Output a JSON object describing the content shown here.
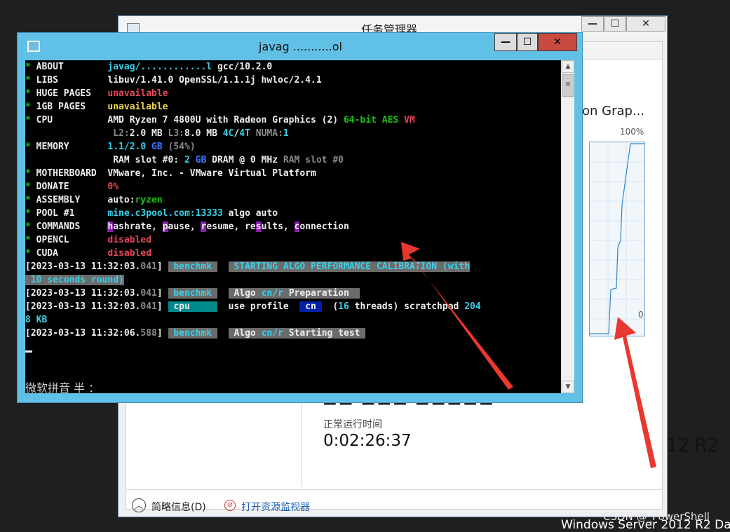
{
  "taskmanager": {
    "title": "任务管理器",
    "graph_title": "on Grap...",
    "graph_max": "100%",
    "graph_min": "0",
    "uptime_label": "正常运行时间",
    "uptime_value": "0:02:26:37",
    "summary_label": "简略信息(D)",
    "resmon_link": "打开资源监视器",
    "os_edition": "12 R2",
    "bottom_text": "Windows Server 2012 R2 Da",
    "watermark": "CSDN @_PowerShell",
    "controls": {
      "minimize": "—",
      "maximize": "☐",
      "close": "✕"
    }
  },
  "console": {
    "title": "javag ...........ol",
    "controls": {
      "minimize": "—",
      "maximize": "☐",
      "close": "✕"
    },
    "ime_status": "微软拼音 半 ：",
    "lines": [
      [
        [
          "* ",
          "g"
        ],
        [
          "ABOUT        ",
          "w"
        ],
        [
          "javag/............l ",
          "c"
        ],
        [
          "gcc/10.2.0",
          "w"
        ]
      ],
      [
        [
          "* ",
          "g"
        ],
        [
          "LIBS         ",
          "w"
        ],
        [
          "libuv/1.41.0 OpenSSL/1.1.1j hwloc/2.4.1",
          "w"
        ]
      ],
      [
        [
          "* ",
          "g"
        ],
        [
          "HUGE PAGES   ",
          "w"
        ],
        [
          "unavailable",
          "r"
        ]
      ],
      [
        [
          "* ",
          "g"
        ],
        [
          "1GB PAGES    ",
          "w"
        ],
        [
          "unavailable",
          "y"
        ]
      ],
      [
        [
          "* ",
          "g"
        ],
        [
          "CPU          ",
          "w"
        ],
        [
          "AMD Ryzen 7 4800U with Radeon Graphics (2) ",
          "w"
        ],
        [
          "64-bit AES ",
          "g"
        ],
        [
          "VM",
          "r"
        ]
      ],
      [
        [
          "             ",
          "w"
        ],
        [
          "   ",
          "w"
        ],
        [
          "L2:",
          "dg"
        ],
        [
          "2.0 MB ",
          "w"
        ],
        [
          "L3:",
          "dg"
        ],
        [
          "8.0 MB ",
          "w"
        ],
        [
          "4C",
          "c"
        ],
        [
          "/",
          "w"
        ],
        [
          "4T ",
          "c"
        ],
        [
          "NUMA:",
          "dg"
        ],
        [
          "1",
          "c"
        ]
      ],
      [
        [
          "* ",
          "g"
        ],
        [
          "MEMORY       ",
          "w"
        ],
        [
          "1.1/2.0 ",
          "c"
        ],
        [
          "GB ",
          "b"
        ],
        [
          "(54%)",
          "dg"
        ]
      ],
      [
        [
          "             ",
          "w"
        ],
        [
          "   ",
          "w"
        ],
        [
          "RAM slot #0: ",
          "w"
        ],
        [
          "2 ",
          "c"
        ],
        [
          "GB ",
          "b"
        ],
        [
          "DRAM @ 0 MHz ",
          "w"
        ],
        [
          "RAM slot #0",
          "dg"
        ]
      ],
      [
        [
          "* ",
          "g"
        ],
        [
          "MOTHERBOARD  ",
          "w"
        ],
        [
          "VMware, Inc. - VMware Virtual Platform",
          "w"
        ]
      ],
      [
        [
          "* ",
          "g"
        ],
        [
          "DONATE       ",
          "w"
        ],
        [
          "0%",
          "r"
        ]
      ],
      [
        [
          "* ",
          "g"
        ],
        [
          "ASSEMBLY     ",
          "w"
        ],
        [
          "auto:",
          "w"
        ],
        [
          "ryzen",
          "g"
        ]
      ],
      [
        [
          "* ",
          "g"
        ],
        [
          "POOL #1      ",
          "w"
        ],
        [
          "mine.c3pool.com:13333 ",
          "c"
        ],
        [
          "algo auto",
          "w"
        ]
      ],
      [
        [
          "* ",
          "g"
        ],
        [
          "COMMANDS     ",
          "w"
        ],
        [
          "h",
          "mk"
        ],
        [
          "ashrate, ",
          "w"
        ],
        [
          "p",
          "mk"
        ],
        [
          "ause, ",
          "w"
        ],
        [
          "r",
          "mk"
        ],
        [
          "esume, re",
          "w"
        ],
        [
          "s",
          "mk"
        ],
        [
          "ults, ",
          "w"
        ],
        [
          "c",
          "mk"
        ],
        [
          "onnection",
          "w"
        ]
      ],
      [
        [
          "* ",
          "g"
        ],
        [
          "OPENCL       ",
          "w"
        ],
        [
          "disabled",
          "r"
        ]
      ],
      [
        [
          "* ",
          "g"
        ],
        [
          "CUDA         ",
          "w"
        ],
        [
          "disabled",
          "r"
        ]
      ],
      [
        [
          "[2023-03-13 11:32:03.",
          "w"
        ],
        [
          "041",
          "dg"
        ],
        [
          "] ",
          "w"
        ],
        [
          " benchmk ",
          "box-g"
        ],
        [
          "  ",
          "w"
        ],
        [
          " STARTING ALGO PERFORMANCE CALIBRATION (with",
          "box-g"
        ]
      ],
      [
        [
          " 10 seconds round)",
          "box-g m"
        ]
      ],
      [
        [
          "[2023-03-13 11:32:03.",
          "w"
        ],
        [
          "041",
          "dg"
        ],
        [
          "] ",
          "w"
        ],
        [
          " benchmk ",
          "box-g"
        ],
        [
          "  ",
          "w"
        ],
        [
          " Algo ",
          "box-gw"
        ],
        [
          "cn/r ",
          "box-g m"
        ],
        [
          "Preparation  ",
          "box-gw"
        ]
      ],
      [
        [
          "[2023-03-13 11:32:03.",
          "w"
        ],
        [
          "041",
          "dg"
        ],
        [
          "] ",
          "w"
        ],
        [
          " cpu     ",
          "box-t"
        ],
        [
          "  ",
          "w"
        ],
        [
          "use profile  ",
          "w"
        ],
        [
          " cn ",
          "box-n"
        ],
        [
          "  (",
          "w"
        ],
        [
          "16 ",
          "c"
        ],
        [
          "threads) scratchpad ",
          "w"
        ],
        [
          "204",
          "c"
        ]
      ],
      [
        [
          "8 KB",
          "c"
        ]
      ],
      [
        [
          "[2023-03-13 11:32:06.",
          "w"
        ],
        [
          "588",
          "dg"
        ],
        [
          "] ",
          "w"
        ],
        [
          " benchmk ",
          "box-g"
        ],
        [
          "  ",
          "w"
        ],
        [
          " Algo ",
          "box-gw"
        ],
        [
          "cn/r ",
          "box-g m"
        ],
        [
          "Starting test ",
          "box-gw"
        ]
      ]
    ]
  }
}
